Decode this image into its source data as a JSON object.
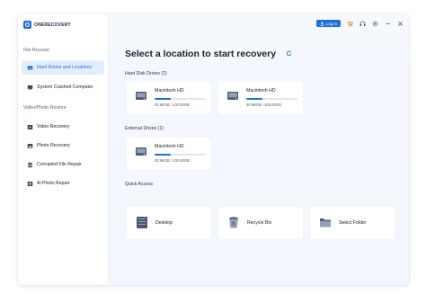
{
  "app": {
    "logo_text": "ONERECOVERY"
  },
  "topbar": {
    "login_label": "Log in",
    "icons": [
      "user-icon",
      "cart-icon",
      "headset-icon",
      "settings-icon",
      "minimize-icon",
      "close-icon"
    ]
  },
  "sidebar": {
    "section_file": "File Recover",
    "section_media": "Video/Photo Restore",
    "items": [
      {
        "label": "Hard Drives and Locations",
        "icon": "drive-icon",
        "active": true
      },
      {
        "label": "System Crashed Computer",
        "icon": "computer-icon",
        "active": false
      },
      {
        "label": "Video Recovery",
        "icon": "video-icon",
        "active": false
      },
      {
        "label": "Photo Recovery",
        "icon": "photo-icon",
        "active": false
      },
      {
        "label": "Corrupted File Repair",
        "icon": "file-repair-icon",
        "active": false
      },
      {
        "label": "Ai Photo Repair",
        "icon": "ai-photo-icon",
        "active": false
      }
    ]
  },
  "main": {
    "title": "Select a location to start recovery",
    "hard_disk_title": "Hard Disk Drives (2)",
    "hard_disks": [
      {
        "name": "Macintosh HD",
        "size": "30.96GB / 100.00GB",
        "used_fraction": 0.31
      },
      {
        "name": "Macintosh HD",
        "size": "30.96GB / 100.00GB",
        "used_fraction": 0.31
      }
    ],
    "external_title": "External Drives (1)",
    "external_drives": [
      {
        "name": "Macintosh HD",
        "size": "30.96GB / 100.00GB",
        "used_fraction": 0.31
      }
    ],
    "quick_access_title": "Quick Access",
    "quick_access": [
      {
        "label": "Desktop",
        "icon": "desktop-icon"
      },
      {
        "label": "Recycle Bin",
        "icon": "recycle-bin-icon"
      },
      {
        "label": "Select Folder",
        "icon": "folder-icon"
      }
    ]
  },
  "colors": {
    "accent": "#1e6fd9",
    "active_bg": "#e3eefc",
    "main_bg": "#f4f8fd"
  }
}
